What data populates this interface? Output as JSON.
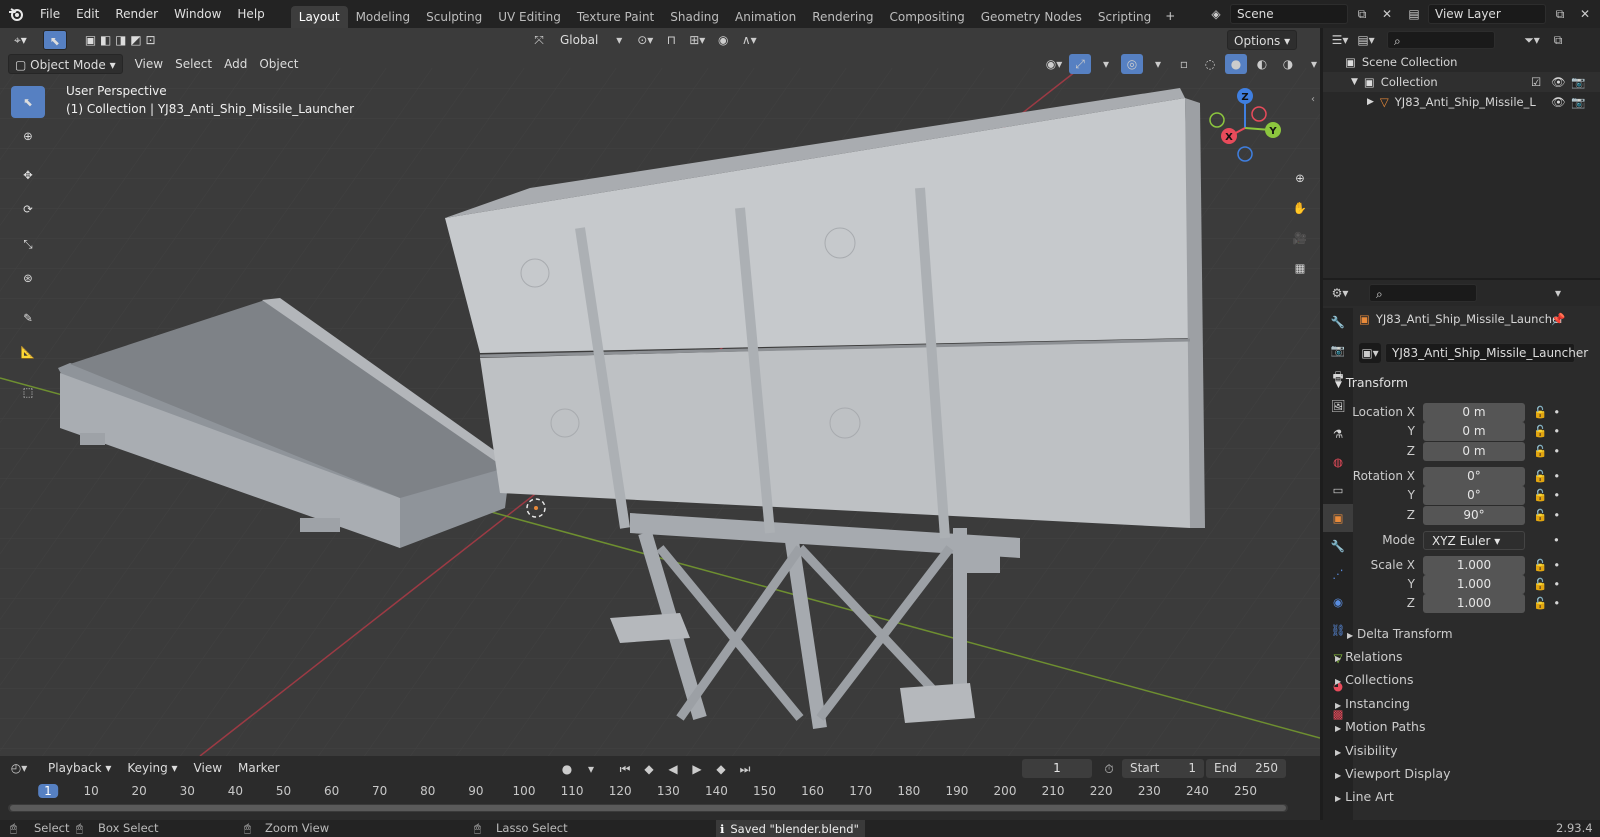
{
  "menus": [
    "File",
    "Edit",
    "Render",
    "Window",
    "Help"
  ],
  "workspaces": [
    "Layout",
    "Modeling",
    "Sculpting",
    "UV Editing",
    "Texture Paint",
    "Shading",
    "Animation",
    "Rendering",
    "Compositing",
    "Geometry Nodes",
    "Scripting"
  ],
  "active_workspace": "Layout",
  "scene": "Scene",
  "view_layer": "View Layer",
  "toolbar": {
    "transform_orientation": "Global",
    "options": "Options"
  },
  "viewport": {
    "mode": "Object Mode",
    "menus": [
      "View",
      "Select",
      "Add",
      "Object"
    ],
    "info_line1": "User Perspective",
    "info_line2": "(1) Collection | YJ83_Anti_Ship_Missile_Launcher",
    "axes": {
      "x": "X",
      "y": "Y",
      "z": "Z"
    }
  },
  "outliner": {
    "root": "Scene Collection",
    "collection": "Collection",
    "object": "YJ83_Anti_Ship_Missile_L"
  },
  "properties": {
    "object_name": "YJ83_Anti_Ship_Missile_Launcher",
    "data_name": "YJ83_Anti_Ship_Missile_Launcher",
    "transform_title": "Transform",
    "location_label": "Location X",
    "location": [
      "0 m",
      "0 m",
      "0 m"
    ],
    "rotation_label": "Rotation X",
    "rotation": [
      "0°",
      "0°",
      "90°"
    ],
    "mode_label": "Mode",
    "mode": "XYZ Euler",
    "scale_label": "Scale X",
    "scale": [
      "1.000",
      "1.000",
      "1.000"
    ],
    "axis_y": "Y",
    "axis_z": "Z",
    "delta": "Delta Transform",
    "panels": [
      "Relations",
      "Collections",
      "Instancing",
      "Motion Paths",
      "Visibility",
      "Viewport Display",
      "Line Art"
    ]
  },
  "timeline": {
    "menus": [
      "Playback",
      "Keying",
      "View",
      "Marker"
    ],
    "current_frame": "1",
    "start_label": "Start",
    "start": "1",
    "end_label": "End",
    "end": "250",
    "ticks": [
      "1",
      "10",
      "20",
      "30",
      "40",
      "50",
      "60",
      "70",
      "80",
      "90",
      "100",
      "110",
      "120",
      "130",
      "140",
      "150",
      "160",
      "170",
      "180",
      "190",
      "200",
      "210",
      "220",
      "230",
      "240",
      "250"
    ]
  },
  "status": {
    "select": "Select",
    "box_select": "Box Select",
    "zoom_view": "Zoom View",
    "lasso_select": "Lasso Select",
    "message": "Saved \"blender.blend\"",
    "version": "2.93.4"
  },
  "colors": {
    "accent": "#5680c2",
    "x_axis": "#e84b5b",
    "y_axis": "#8cc63e",
    "z_axis": "#3f7fe0",
    "object_orange": "#e88a3a"
  }
}
